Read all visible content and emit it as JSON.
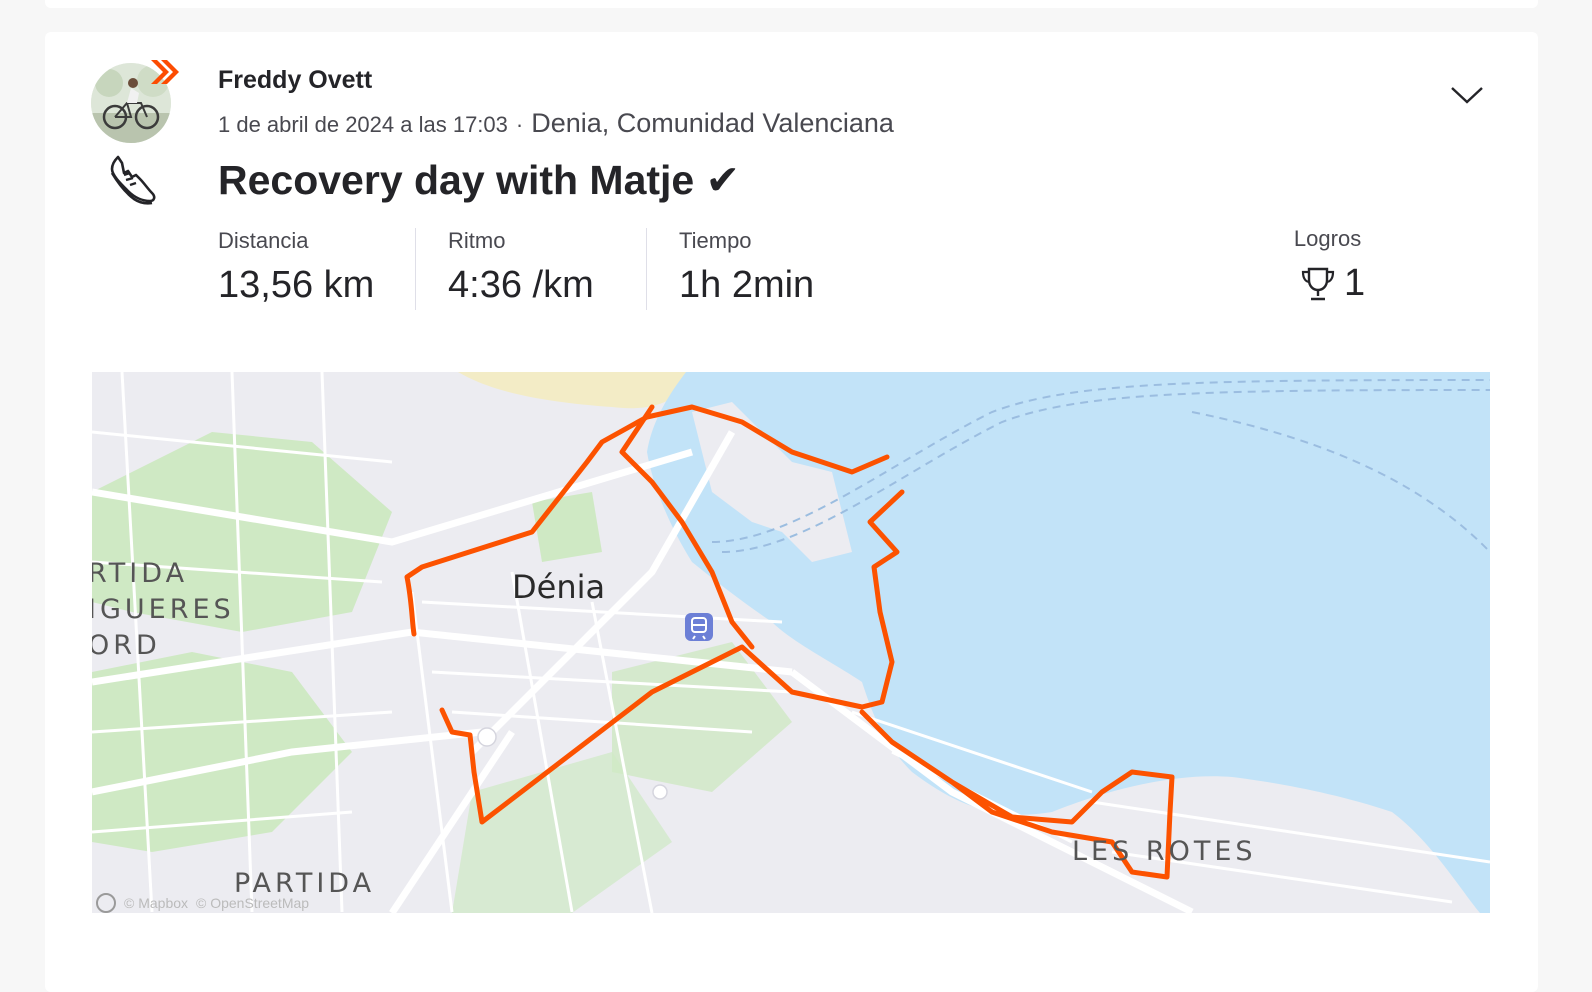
{
  "activity": {
    "athlete_name": "Freddy Ovett",
    "date": "1 de abril de 2024 a las 17:03",
    "separator": "·",
    "location": "Denia, Comunidad Valenciana",
    "title": "Recovery day with Matje ✔︎",
    "sport_icon": "running-shoe-icon",
    "subscriber_badge_icon": "chevron-badge-icon",
    "brand_color": "#fc4c02"
  },
  "stats": [
    {
      "label": "Distancia",
      "value": "13,56 km"
    },
    {
      "label": "Ritmo",
      "value": "4:36 /km"
    },
    {
      "label": "Tiempo",
      "value": "1h 2min"
    }
  ],
  "achievements": {
    "label": "Logros",
    "count": "1",
    "icon": "trophy-icon"
  },
  "map": {
    "city": "Dénia",
    "area_labels": [
      "RTIDA",
      "IGUERES",
      "ORD",
      "PARTIDA",
      "LES ROTES"
    ],
    "attribution": [
      "© Mapbox",
      "© OpenStreetMap"
    ],
    "route_color": "#fc5200",
    "water_color": "#c2e3f8",
    "land_color": "#ececf1",
    "park_color": "#cfe9c4"
  }
}
